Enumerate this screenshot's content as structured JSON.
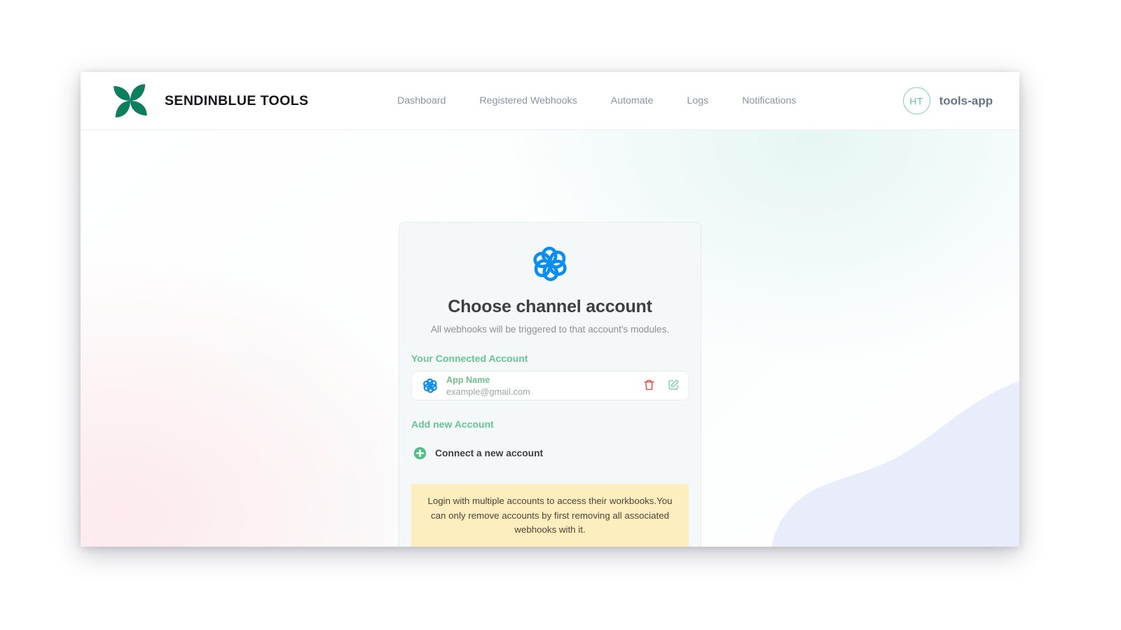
{
  "header": {
    "logo_icon": "sendinblue-pinwheel-green-logo",
    "brand_name": "SENDINBLUE TOOLS",
    "nav": [
      {
        "label": "Dashboard"
      },
      {
        "label": "Registered Webhooks"
      },
      {
        "label": "Automate"
      },
      {
        "label": "Logs"
      },
      {
        "label": "Notifications"
      }
    ],
    "user": {
      "avatar_initials": "HT",
      "name": "tools-app"
    }
  },
  "card": {
    "logo_icon": "sendinblue-pinwheel-blue-logo",
    "title": "Choose channel account",
    "subtitle": "All webhooks will be triggered to that account's modules.",
    "connected_section_label": "Your Connected Account",
    "accounts": [
      {
        "icon": "sendinblue-pinwheel-blue-icon",
        "name": "App Name",
        "email": "example@gmail.com",
        "delete_icon": "trash-icon",
        "edit_icon": "edit-pencil-square-icon"
      }
    ],
    "add_section_label": "Add new Account",
    "connect": {
      "icon": "plus-circle-icon",
      "label": "Connect a new account"
    },
    "notice": "Login with multiple accounts to access their workbooks.You can only remove accounts by first removing all associated webhooks with it."
  },
  "colors": {
    "brand_green": "#0d7f5f",
    "accent_green": "#68c493",
    "sendinblue_blue": "#0b8ef0",
    "danger_red": "#f5372b",
    "edit_teal": "#6fc3a8",
    "notice_bg": "#fdeebf",
    "card_bg": "#f4f8f8",
    "blob_lavender": "#e9ecfa",
    "user_name": "#67738c"
  }
}
